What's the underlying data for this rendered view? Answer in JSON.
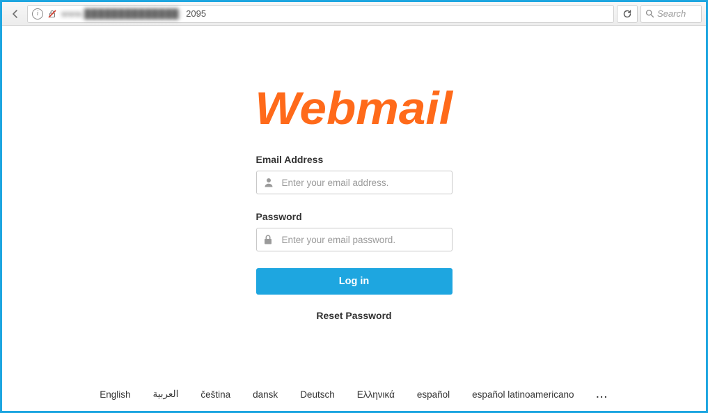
{
  "browser": {
    "url_obscured": "www.██████████████:",
    "url_port": "2095",
    "search_placeholder": "Search"
  },
  "logo": {
    "text": "Webmail"
  },
  "form": {
    "email": {
      "label": "Email Address",
      "placeholder": "Enter your email address."
    },
    "password": {
      "label": "Password",
      "placeholder": "Enter your email password."
    },
    "login_label": "Log in",
    "reset_label": "Reset Password"
  },
  "languages": {
    "items": [
      "English",
      "العربية",
      "čeština",
      "dansk",
      "Deutsch",
      "Ελληνικά",
      "español",
      "español latinoamericano"
    ],
    "more": "..."
  }
}
